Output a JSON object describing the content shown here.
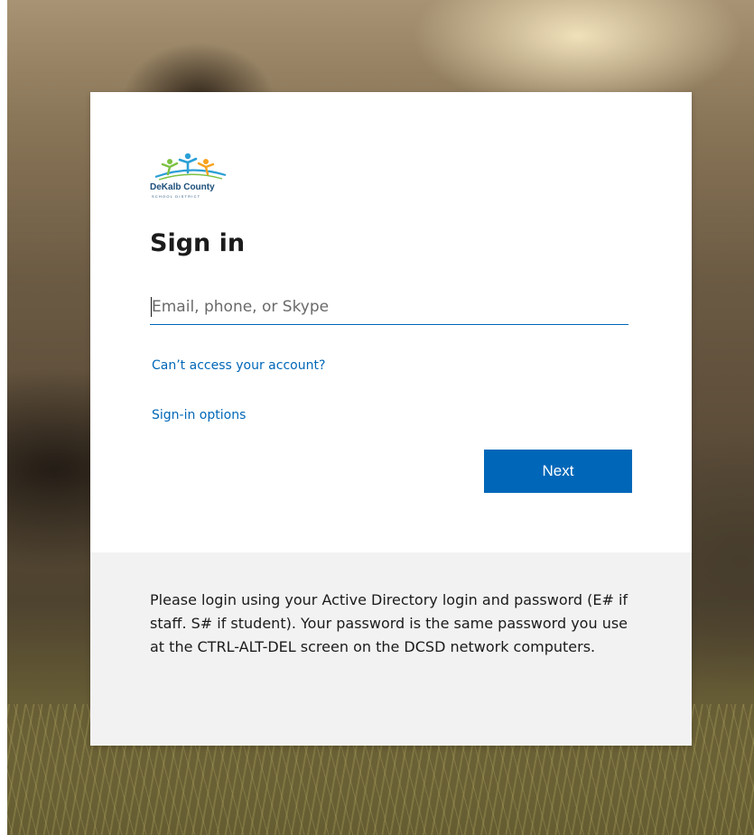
{
  "colors": {
    "accent": "#0067b8",
    "footer_background": "#f2f2f2",
    "card_background": "#ffffff"
  },
  "logo": {
    "name": "DeKalb County",
    "subtitle": "SCHOOL DISTRICT",
    "icon": "figures-logo"
  },
  "signin": {
    "title": "Sign in",
    "email_placeholder": "Email, phone, or Skype",
    "email_value": "",
    "cant_access_link": "Can’t access your account?",
    "signin_options_link": "Sign-in options",
    "next_label": "Next"
  },
  "footer": {
    "message": "Please login using your Active Directory login and password (E# if staff. S# if student). Your password is the same password you use at the CTRL-ALT-DEL screen on the DCSD network computers."
  }
}
